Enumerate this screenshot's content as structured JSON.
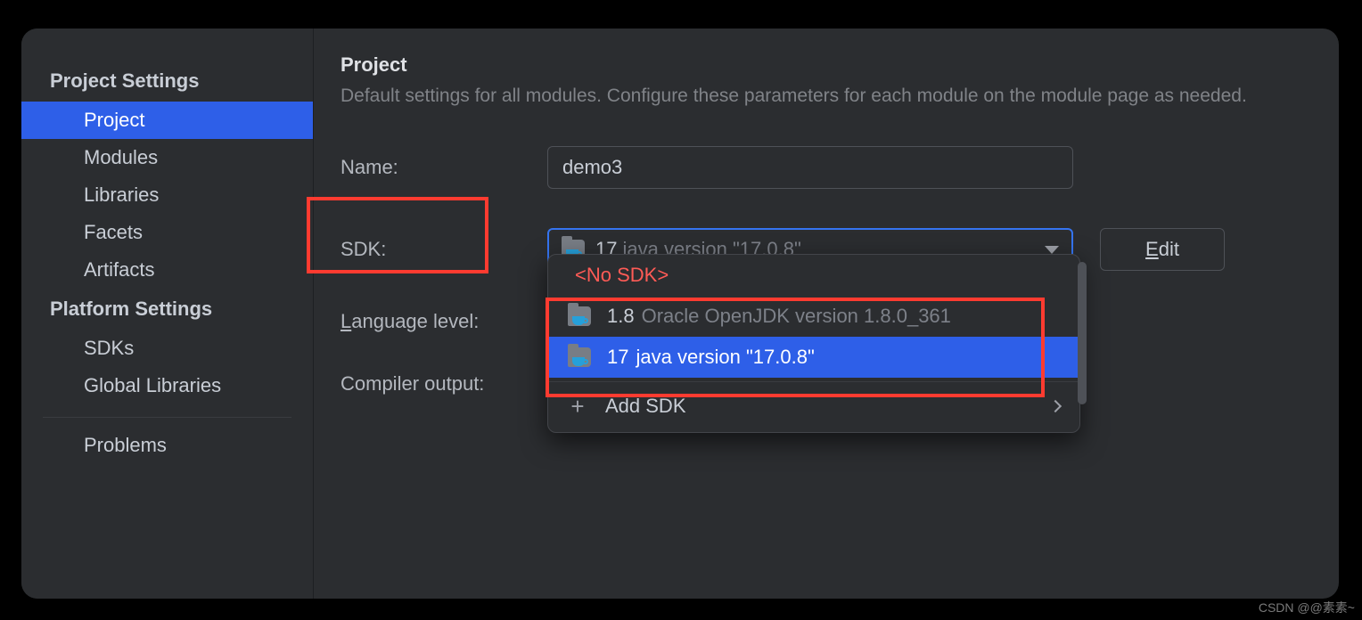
{
  "sidebar": {
    "heading_project": "Project Settings",
    "heading_platform": "Platform Settings",
    "items": {
      "project": "Project",
      "modules": "Modules",
      "libraries": "Libraries",
      "facets": "Facets",
      "artifacts": "Artifacts",
      "sdks": "SDKs",
      "global_libraries": "Global Libraries",
      "problems": "Problems"
    }
  },
  "main": {
    "title": "Project",
    "description": "Default settings for all modules. Configure these parameters for each module on the module page as needed.",
    "labels": {
      "name": "Name:",
      "sdk": "SDK:",
      "language_level_prefix": "L",
      "language_level_rest": "anguage level:",
      "compiler_output": "Compiler output:"
    },
    "name_value": "demo3",
    "sdk_selected": {
      "version": "17",
      "detail": "java version \"17.0.8\""
    },
    "edit_prefix": "E",
    "edit_rest": "dit"
  },
  "dropdown": {
    "no_sdk": "<No SDK>",
    "options": [
      {
        "version": "1.8",
        "detail": "Oracle OpenJDK version 1.8.0_361",
        "selected": false
      },
      {
        "version": "17",
        "detail": "java version \"17.0.8\"",
        "selected": true
      }
    ],
    "add_sdk": "Add SDK"
  },
  "watermark": "CSDN @@素素~"
}
